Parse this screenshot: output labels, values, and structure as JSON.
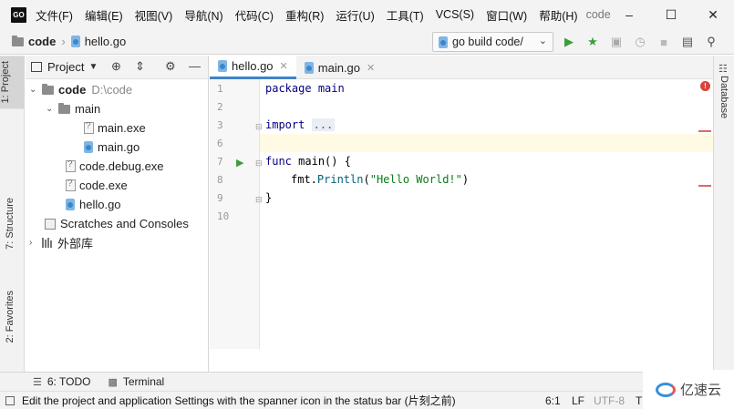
{
  "app": {
    "logo_text": "GO",
    "window_title": "code",
    "menu": [
      "文件(F)",
      "编辑(E)",
      "视图(V)",
      "导航(N)",
      "代码(C)",
      "重构(R)",
      "运行(U)",
      "工具(T)",
      "VCS(S)",
      "窗口(W)",
      "帮助(H)"
    ]
  },
  "breadcrumb": {
    "project": "code",
    "file": "hello.go"
  },
  "run_config": {
    "label": "go build code/"
  },
  "left_strip": {
    "project": "1: Project",
    "structure": "7: Structure",
    "favorites": "2: Favorites"
  },
  "project_panel": {
    "title": "Project",
    "tree": [
      {
        "label": "code",
        "hint": "D:\\code",
        "kind": "folder",
        "bold": true,
        "expanded": true
      },
      {
        "label": "main",
        "kind": "folder",
        "expanded": true
      },
      {
        "label": "main.exe",
        "kind": "exe"
      },
      {
        "label": "main.go",
        "kind": "go"
      },
      {
        "label": "code.debug.exe",
        "kind": "exe"
      },
      {
        "label": "code.exe",
        "kind": "exe"
      },
      {
        "label": "hello.go",
        "kind": "go"
      },
      {
        "label": "Scratches and Consoles",
        "kind": "scratch"
      },
      {
        "label": "外部库",
        "kind": "libs"
      }
    ]
  },
  "editor": {
    "tabs": [
      {
        "label": "hello.go",
        "active": true
      },
      {
        "label": "main.go",
        "active": false
      }
    ],
    "line_numbers": [
      "1",
      "2",
      "3",
      "6",
      "7",
      "8",
      "9",
      "10"
    ],
    "code": {
      "package_kw": "package",
      "package_name": "main",
      "import_kw": "import",
      "import_folded": "...",
      "func_kw": "func",
      "func_sig": "main() {",
      "call_pkg": "fmt.",
      "call_fn": "Println",
      "call_open": "(",
      "call_str": "\"Hello World!\"",
      "call_close": ")",
      "close_brace": "}"
    }
  },
  "right_strip": {
    "database": "Database"
  },
  "tool_strip": {
    "todo": "6: TODO",
    "terminal": "Terminal"
  },
  "status_bar": {
    "message": "Edit the project and application Settings with the spanner icon in the status bar (片刻之前)",
    "position": "6:1",
    "line_sep": "LF",
    "encoding": "UTF-8",
    "extra": "T"
  },
  "watermark": {
    "text": "亿速云"
  },
  "colors": {
    "accent": "#4083c9",
    "run_green": "#3c9d3c",
    "error_red": "#d9443a",
    "caret_line": "#fffae3"
  }
}
